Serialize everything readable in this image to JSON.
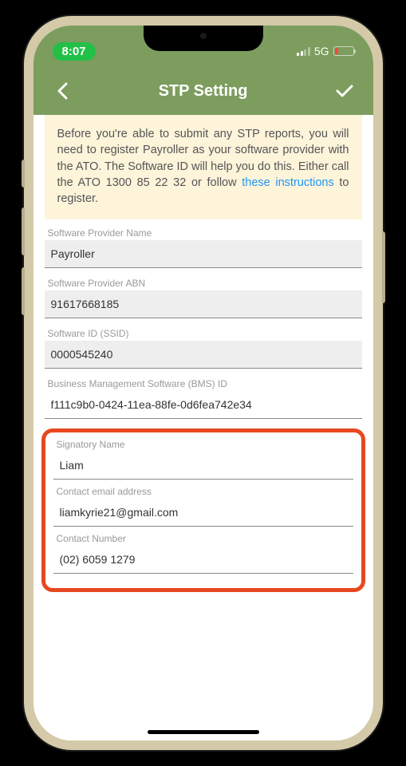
{
  "status_bar": {
    "time": "8:07",
    "network": "5G"
  },
  "nav": {
    "title": "STP Setting"
  },
  "info": {
    "text_before_link": "Before you're able to submit any STP reports, you will need to register Payroller as your software provider with the ATO. The Software ID will help you do this. Either call the ATO 1300 85 22 32 or follow ",
    "link_text": "these instructions",
    "text_after_link": " to register."
  },
  "fields": {
    "software_provider_name": {
      "label": "Software Provider Name",
      "value": "Payroller"
    },
    "software_provider_abn": {
      "label": "Software Provider ABN",
      "value": "91617668185"
    },
    "software_id": {
      "label": "Software ID (SSID)",
      "value": "0000545240"
    },
    "bms_id": {
      "label": "Business Management Software (BMS) ID",
      "value": "f111c9b0-0424-11ea-88fe-0d6fea742e34"
    },
    "signatory_name": {
      "label": "Signatory Name",
      "value": "Liam"
    },
    "contact_email": {
      "label": "Contact email address",
      "value": "liamkyrie21@gmail.com"
    },
    "contact_number": {
      "label": "Contact Number",
      "value": "(02) 6059 1279"
    }
  }
}
